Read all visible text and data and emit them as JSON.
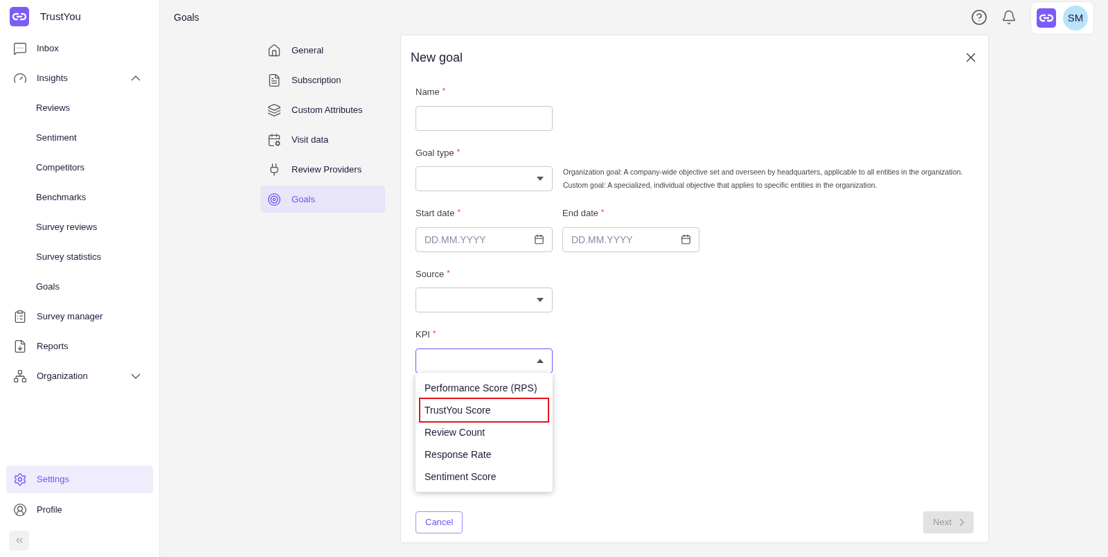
{
  "brand": {
    "name": "TrustYou"
  },
  "sidebar": {
    "items": [
      {
        "kind": "item",
        "label": "Inbox",
        "selected": false
      },
      {
        "kind": "group",
        "label": "Insights",
        "selected": false,
        "expanded": true,
        "children": [
          {
            "label": "Reviews",
            "selected": false
          },
          {
            "label": "Sentiment",
            "selected": false
          },
          {
            "label": "Competitors",
            "selected": false
          },
          {
            "label": "Benchmarks",
            "selected": false
          },
          {
            "label": "Survey reviews",
            "selected": false
          },
          {
            "label": "Survey statistics",
            "selected": false
          },
          {
            "label": "Goals",
            "selected": false
          }
        ]
      },
      {
        "kind": "item",
        "label": "Survey manager",
        "selected": false
      },
      {
        "kind": "item",
        "label": "Reports",
        "selected": false
      },
      {
        "kind": "group",
        "label": "Organization",
        "selected": false,
        "expanded": false
      }
    ],
    "bottom_items": [
      {
        "label": "Settings",
        "selected": true
      },
      {
        "label": "Profile",
        "selected": false
      }
    ]
  },
  "header": {
    "title": "Goals",
    "avatar": "SM"
  },
  "settings_nav": [
    {
      "label": "General",
      "selected": false
    },
    {
      "label": "Subscription",
      "selected": false
    },
    {
      "label": "Custom Attributes",
      "selected": false
    },
    {
      "label": "Visit data",
      "selected": false
    },
    {
      "label": "Review Providers",
      "selected": false
    },
    {
      "label": "Goals",
      "selected": true
    }
  ],
  "dialog": {
    "title": "New goal",
    "fields": [
      {
        "kind": "text",
        "label": "Name",
        "required_mark": "*"
      },
      {
        "kind": "select",
        "label": "Goal type",
        "required_mark": "*",
        "open": false,
        "help": [
          "Organization goal: A company-wide objective set and overseen by headquarters, applicable to all entities in the organization.",
          "Custom goal: A specialized, individual objective that applies to specific entities in the organization."
        ]
      },
      {
        "kind": "dates",
        "items": [
          {
            "label": "Start date",
            "required_mark": "*",
            "placeholder": "DD.MM.YYYY"
          },
          {
            "label": "End date",
            "required_mark": "*",
            "placeholder": "DD.MM.YYYY"
          }
        ]
      },
      {
        "kind": "select",
        "label": "Source",
        "required_mark": "*",
        "open": false
      },
      {
        "kind": "select",
        "label": "KPI",
        "required_mark": "*",
        "open": true,
        "options": [
          {
            "label": "Performance Score (RPS)",
            "highlighted": false
          },
          {
            "label": "TrustYou Score",
            "highlighted": true
          },
          {
            "label": "Review Count",
            "highlighted": false
          },
          {
            "label": "Response Rate",
            "highlighted": false
          },
          {
            "label": "Sentiment Score",
            "highlighted": false
          }
        ]
      }
    ],
    "cancel": "Cancel",
    "next": {
      "label": "Next",
      "disabled": true
    }
  }
}
